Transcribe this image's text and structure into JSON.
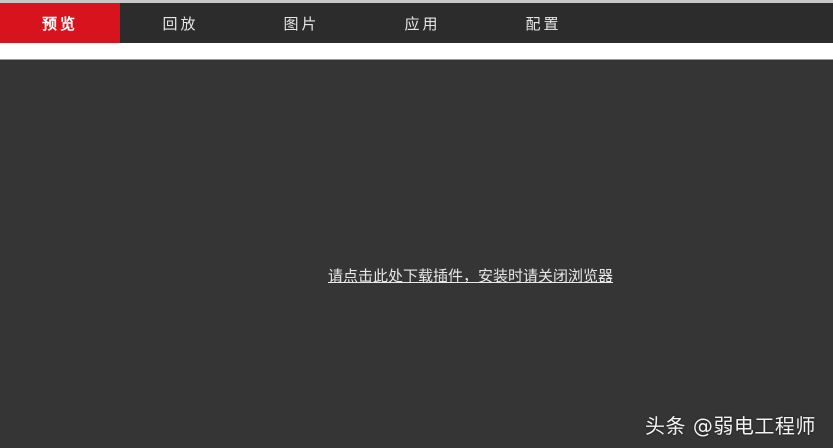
{
  "nav": {
    "items": [
      {
        "label": "预览",
        "active": true
      },
      {
        "label": "回放",
        "active": false
      },
      {
        "label": "图片",
        "active": false
      },
      {
        "label": "应用",
        "active": false
      },
      {
        "label": "配置",
        "active": false
      }
    ]
  },
  "main": {
    "plugin_link_text": "请点击此处下载插件，安装时请关闭浏览器"
  },
  "watermark": {
    "text": "头条 @弱电工程师"
  },
  "colors": {
    "accent": "#d7141d",
    "navbar_bg": "#2c2c2c",
    "content_bg": "#353535"
  }
}
